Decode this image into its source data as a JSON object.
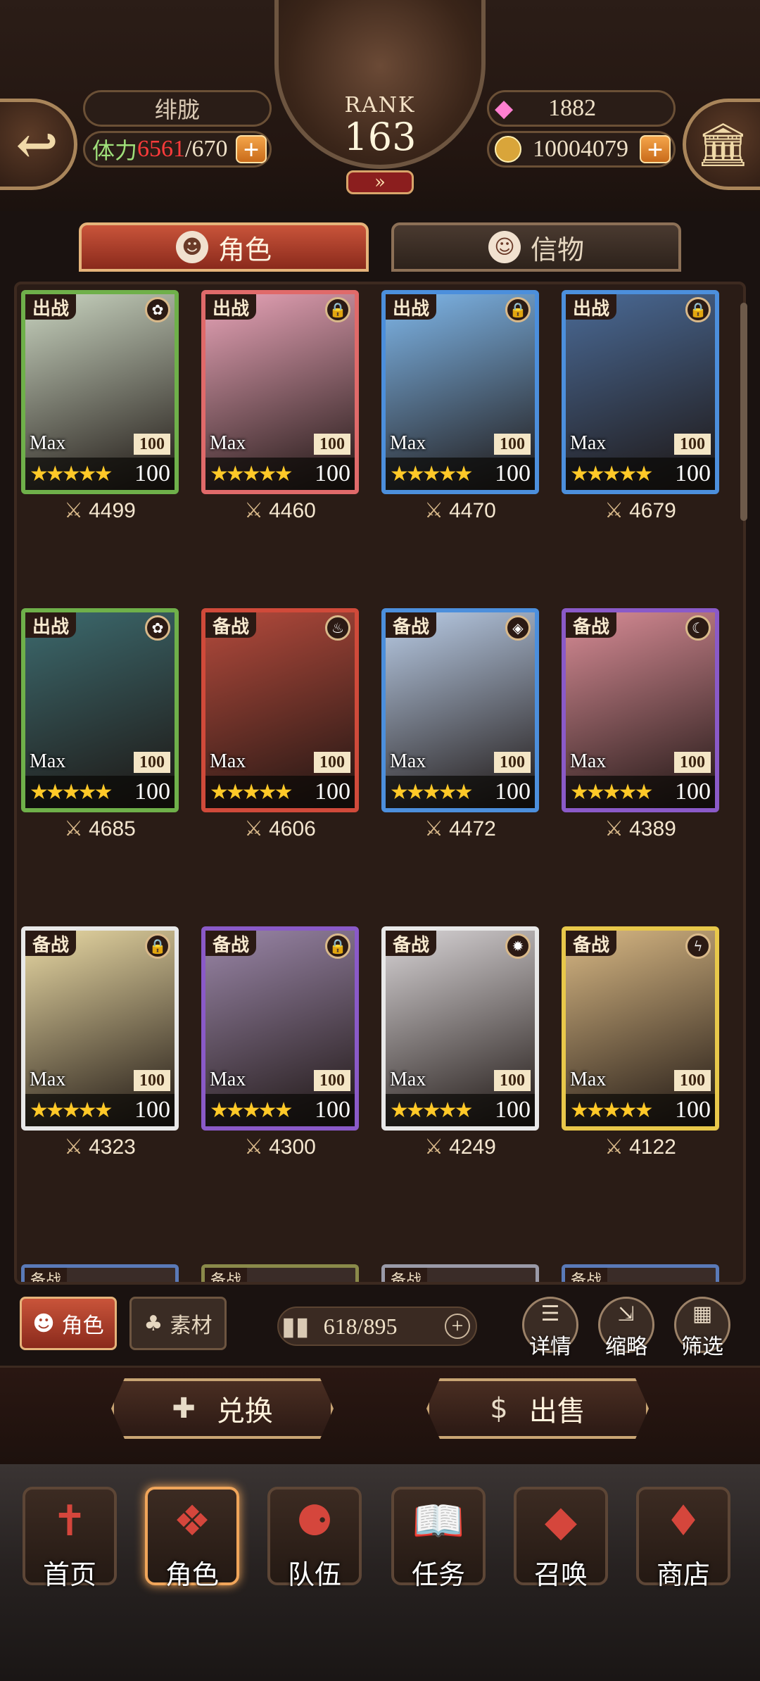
{
  "header": {
    "player_name": "绯胧",
    "stamina_label": "体力",
    "stamina_current": "6561",
    "stamina_max": "/670",
    "rank_label": "RANK",
    "rank_value": "163",
    "gems": "1882",
    "gold": "10004079",
    "fast_forward": "»"
  },
  "tabs": [
    {
      "label": "角色",
      "active": true
    },
    {
      "label": "信物",
      "active": false
    }
  ],
  "cards": [
    {
      "tag": "出战",
      "level_label": "Max",
      "level": "100",
      "star_level": "100",
      "power": "4499",
      "frame": "#6fb04a",
      "art": "#c9d4c0",
      "elem": "leaf-icon"
    },
    {
      "tag": "出战",
      "level_label": "Max",
      "level": "100",
      "star_level": "100",
      "power": "4460",
      "frame": "#e06a6a",
      "art": "#e8a4b8",
      "elem": "lock-icon"
    },
    {
      "tag": "出战",
      "level_label": "Max",
      "level": "100",
      "star_level": "100",
      "power": "4470",
      "frame": "#4c8fdc",
      "art": "#7fb7ea",
      "elem": "lock-icon"
    },
    {
      "tag": "出战",
      "level_label": "Max",
      "level": "100",
      "star_level": "100",
      "power": "4679",
      "frame": "#4c8fdc",
      "art": "#4a6a96",
      "elem": "lock-icon"
    },
    {
      "tag": "出战",
      "level_label": "Max",
      "level": "100",
      "star_level": "100",
      "power": "4685",
      "frame": "#6fb04a",
      "art": "#3c6a6e",
      "elem": "leaf-icon"
    },
    {
      "tag": "备战",
      "level_label": "Max",
      "level": "100",
      "star_level": "100",
      "power": "4606",
      "frame": "#d04a3a",
      "art": "#b44a3c",
      "elem": "fire-icon"
    },
    {
      "tag": "备战",
      "level_label": "Max",
      "level": "100",
      "star_level": "100",
      "power": "4472",
      "frame": "#4c8fdc",
      "art": "#b9cce6",
      "elem": "water-icon"
    },
    {
      "tag": "备战",
      "level_label": "Max",
      "level": "100",
      "star_level": "100",
      "power": "4389",
      "frame": "#8a5ac8",
      "art": "#d88c96",
      "elem": "moon-icon"
    },
    {
      "tag": "备战",
      "level_label": "Max",
      "level": "100",
      "star_level": "100",
      "power": "4323",
      "frame": "#e8e8e8",
      "art": "#e9d9a4",
      "elem": "lock-icon"
    },
    {
      "tag": "备战",
      "level_label": "Max",
      "level": "100",
      "star_level": "100",
      "power": "4300",
      "frame": "#8a5ac8",
      "art": "#9a86a8",
      "elem": "lock-icon"
    },
    {
      "tag": "备战",
      "level_label": "Max",
      "level": "100",
      "star_level": "100",
      "power": "4249",
      "frame": "#e8e8e8",
      "art": "#d8d4d6",
      "elem": "gear-icon"
    },
    {
      "tag": "备战",
      "level_label": "Max",
      "level": "100",
      "star_level": "100",
      "power": "4122",
      "frame": "#e8c84a",
      "art": "#d8b884",
      "elem": "lightning-icon"
    }
  ],
  "peek_cards": [
    {
      "tag": "备战",
      "frame": "#5a7ab8"
    },
    {
      "tag": "备战",
      "frame": "#8a8a4a"
    },
    {
      "tag": "备战",
      "frame": "#9a9aa8"
    },
    {
      "tag": "备战",
      "frame": "#5a7ab8"
    }
  ],
  "filters": {
    "character_label": "角色",
    "material_label": "素材",
    "capacity": "618/895"
  },
  "tools": {
    "details": "详情",
    "compact": "缩略",
    "filter": "筛选"
  },
  "actions": {
    "exchange": "兑换",
    "sell": "出售"
  },
  "nav": [
    {
      "label": "首页",
      "icon": "home-banner-icon",
      "active": false
    },
    {
      "label": "角色",
      "icon": "character-card-icon",
      "active": true
    },
    {
      "label": "队伍",
      "icon": "team-icon",
      "active": false
    },
    {
      "label": "任务",
      "icon": "quest-book-icon",
      "active": false
    },
    {
      "label": "召唤",
      "icon": "summon-card-icon",
      "active": false
    },
    {
      "label": "商店",
      "icon": "shop-gem-icon",
      "active": false
    }
  ],
  "colors": {
    "accent_orange": "#f0a55a",
    "stamina_red": "#ff3b3b",
    "star_gold": "#ffc928"
  }
}
